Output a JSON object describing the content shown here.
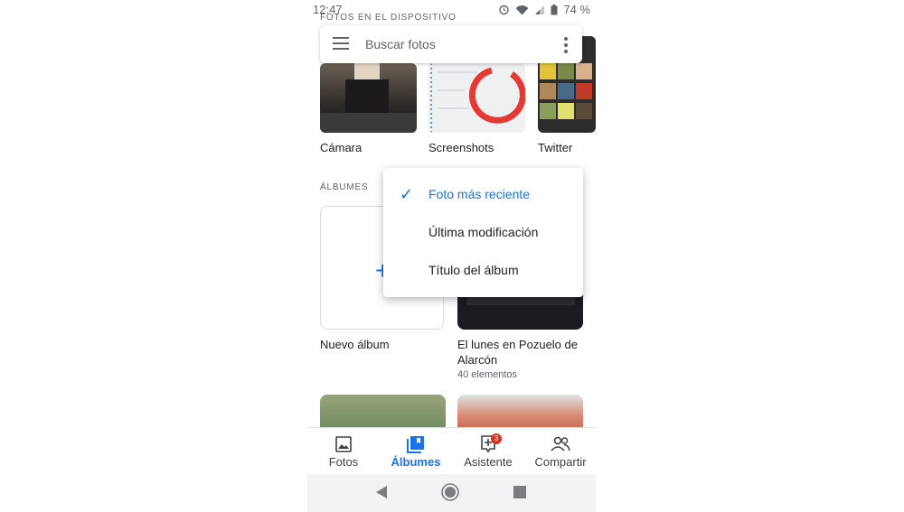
{
  "status_bar": {
    "time": "12:47",
    "battery": "74 %"
  },
  "sections": {
    "device": "FOTOS EN EL DISPOSITIVO",
    "albums": "ÁLBUMES"
  },
  "search": {
    "placeholder": "Buscar fotos"
  },
  "device_folders": [
    {
      "name": "Cámara"
    },
    {
      "name": "Screenshots"
    },
    {
      "name": "Twitter"
    }
  ],
  "albums": [
    {
      "name": "Nuevo álbum"
    },
    {
      "name": "El lunes en Pozuelo de Alarcón",
      "count": "40 elementos"
    }
  ],
  "sort_menu": {
    "options": [
      {
        "label": "Foto más reciente",
        "selected": true
      },
      {
        "label": "Última modificación",
        "selected": false
      },
      {
        "label": "Título del álbum",
        "selected": false
      }
    ]
  },
  "bottom_nav": {
    "items": [
      {
        "label": "Fotos",
        "icon": "photo-icon"
      },
      {
        "label": "Álbumes",
        "icon": "albums-icon",
        "active": true
      },
      {
        "label": "Asistente",
        "icon": "assistant-icon",
        "badge": "3"
      },
      {
        "label": "Compartir",
        "icon": "people-icon"
      }
    ]
  },
  "colors": {
    "accent": "#1a73e8",
    "badge": "#d93025"
  }
}
